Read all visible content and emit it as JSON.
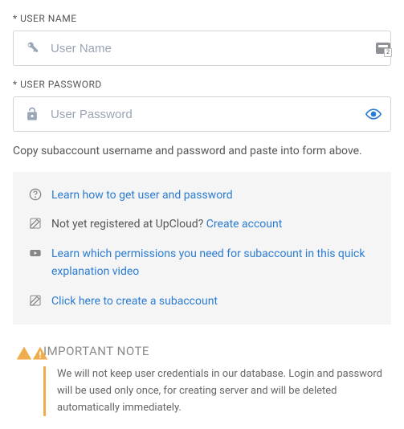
{
  "username": {
    "label": "* USER NAME",
    "placeholder": "User Name",
    "value": ""
  },
  "password": {
    "label": "* USER PASSWORD",
    "placeholder": "User Password",
    "value": ""
  },
  "help_text": "Copy subaccount username and password and paste into form above.",
  "info": {
    "learn_user_pass": "Learn how to get user and password",
    "not_registered_prefix": "Not yet registered at UpCloud? ",
    "create_account": "Create account",
    "learn_permissions": "Learn which permissions you need for subaccount in this quick explanation video",
    "create_subaccount": "Click here to create a subaccount"
  },
  "note": {
    "title": "IMPORTANT NOTE",
    "body": "We will not keep user credentials in our database. Login and password will be used only once, for creating server and will be deleted automatically immediately."
  },
  "colors": {
    "link": "#2b7cd3",
    "warning": "#f0ad4e",
    "icon_gray": "#9aa5b5"
  }
}
